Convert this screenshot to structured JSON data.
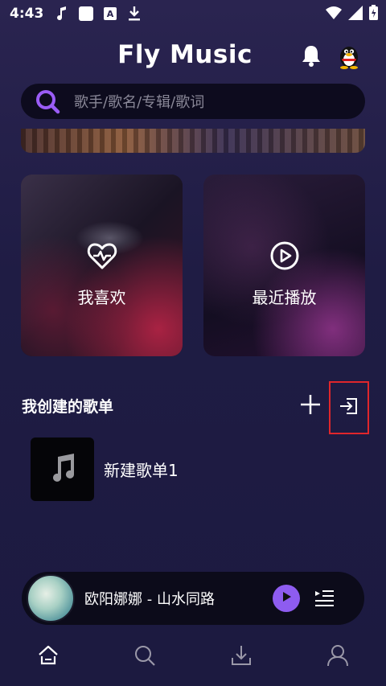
{
  "status_bar": {
    "time": "4:43",
    "icons_left": [
      "music-note-icon",
      "square-icon",
      "font-icon",
      "download-arrow-icon"
    ],
    "icons_right": [
      "wifi-icon",
      "signal-icon",
      "battery-icon"
    ]
  },
  "header": {
    "title": "Fly Music",
    "bell_icon": "bell-icon",
    "avatar_icon": "qq-penguin-icon"
  },
  "search": {
    "placeholder": "歌手/歌名/专辑/歌词"
  },
  "cards": [
    {
      "label": "我喜欢",
      "icon": "heart-pulse-icon"
    },
    {
      "label": "最近播放",
      "icon": "play-circle-icon"
    }
  ],
  "section": {
    "title": "我创建的歌单",
    "add_icon": "plus-icon",
    "import_icon": "import-icon"
  },
  "playlists": [
    {
      "name": "新建歌单1",
      "icon": "music-note-icon"
    }
  ],
  "player": {
    "now_playing": "欧阳娜娜 - 山水同路",
    "accent_color": "#8e5cf0"
  },
  "nav": {
    "items": [
      "home-icon",
      "search-icon",
      "download-icon",
      "profile-icon"
    ]
  },
  "colors": {
    "highlight_box": "#e0262b",
    "background": "#1f1c44"
  }
}
